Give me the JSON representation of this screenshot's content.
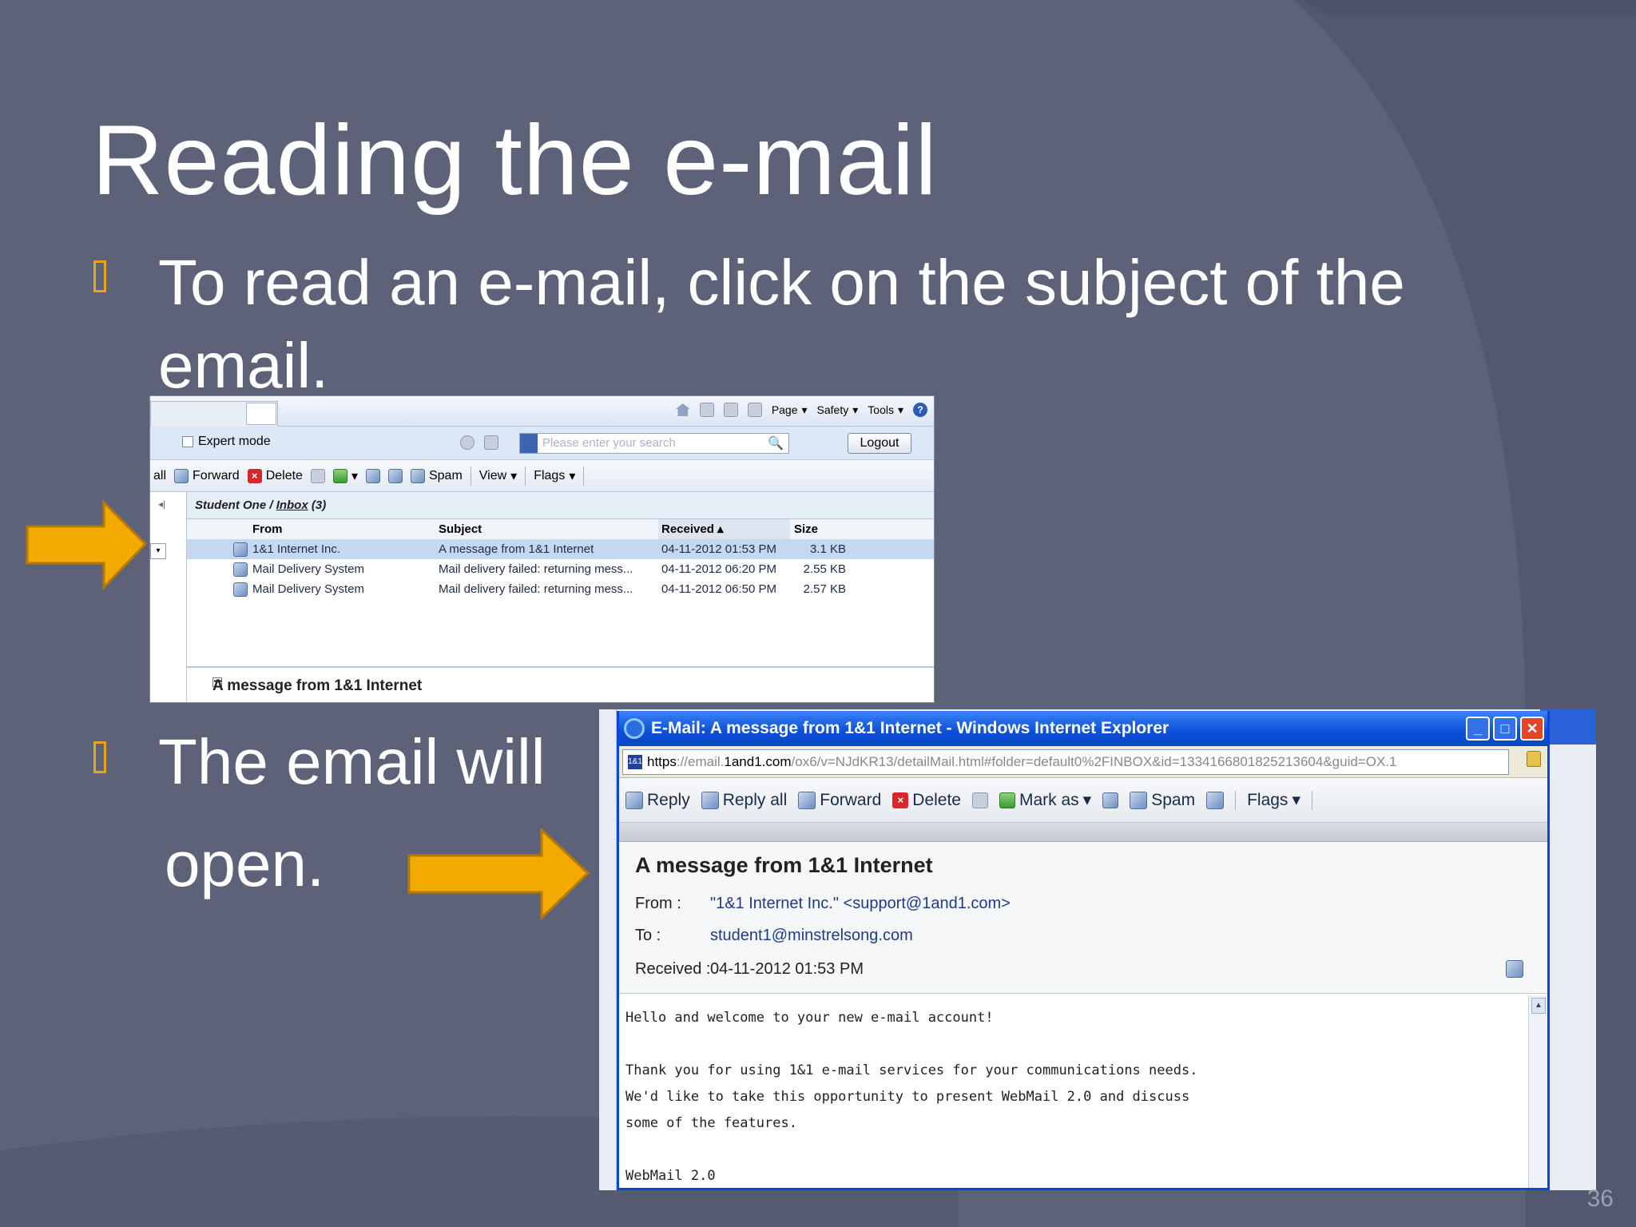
{
  "slide": {
    "title": "Reading the e-mail",
    "bullet1": "To read an e-mail, click on the subject of the email.",
    "bullet2_line1": "The email will",
    "bullet2_line2": "open.",
    "slide_number": "36",
    "accent_color": "#e8a317",
    "background_color": "#5d6279"
  },
  "webmail": {
    "commandbar": {
      "page": "Page",
      "safety": "Safety",
      "tools": "Tools"
    },
    "expert_mode": "Expert mode",
    "search_placeholder": "Please enter your search",
    "logout": "Logout",
    "toolbar": {
      "all": "all",
      "forward": "Forward",
      "delete": "Delete",
      "spam": "Spam",
      "view": "View",
      "flags": "Flags"
    },
    "path": {
      "user": "Student One",
      "sep": " / ",
      "folder": "Inbox",
      "count": "(3)"
    },
    "columns": {
      "from": "From",
      "subject": "Subject",
      "received": "Received",
      "size": "Size"
    },
    "messages": [
      {
        "from": "1&1 Internet Inc.",
        "subject": "A message from 1&1 Internet",
        "received": "04-11-2012 01:53 PM",
        "size": "3.1 KB"
      },
      {
        "from": "Mail Delivery System",
        "subject": "Mail delivery failed: returning mess...",
        "received": "04-11-2012 06:20 PM",
        "size": "2.55 KB"
      },
      {
        "from": "Mail Delivery System",
        "subject": "Mail delivery failed: returning mess...",
        "received": "04-11-2012 06:50 PM",
        "size": "2.57 KB"
      }
    ],
    "preview_title": "A message from 1&1 Internet"
  },
  "mailwindow": {
    "title": "E-Mail: A message from 1&1 Internet - Windows Internet Explorer",
    "url_prefix": "https",
    "url_mid": "://email.",
    "url_host": "1and1.com",
    "url_rest": "/ox6/v=NJdKR13/detailMail.html#folder=default0%2FINBOX&id=1334166801825213604&guid=OX.1",
    "toolbar": {
      "reply": "Reply",
      "reply_all": "Reply all",
      "forward": "Forward",
      "delete": "Delete",
      "mark_as": "Mark as",
      "spam": "Spam",
      "flags": "Flags"
    },
    "subject": "A message from 1&1 Internet",
    "from_label": "From :",
    "from_value": "\"1&1 Internet Inc.\" <support@1and1.com>",
    "to_label": "To :",
    "to_value": "student1@minstrelsong.com",
    "received_label": "Received :",
    "received_value": "04-11-2012 01:53 PM",
    "body": "Hello and welcome to your new e-mail account!\n\nThank you for using 1&1 e-mail services for your communications needs.\nWe'd like to take this opportunity to present WebMail 2.0 and discuss\nsome of the features.\n\nWebMail 2.0"
  }
}
